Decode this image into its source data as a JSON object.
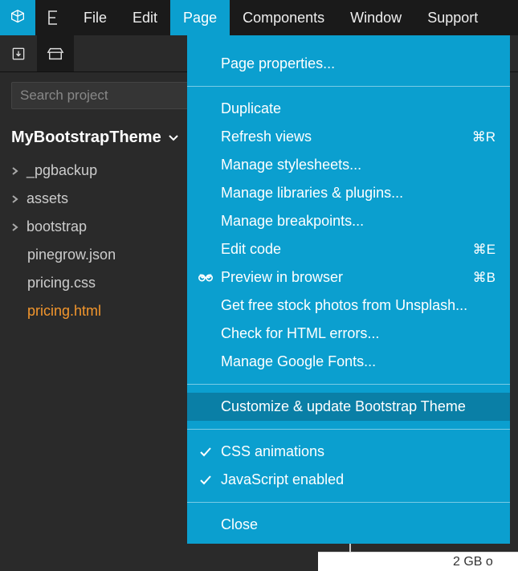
{
  "menubar": {
    "items": [
      {
        "label": "File"
      },
      {
        "label": "Edit"
      },
      {
        "label": "Page",
        "active": true
      },
      {
        "label": "Components"
      },
      {
        "label": "Window"
      },
      {
        "label": "Support"
      }
    ]
  },
  "search": {
    "placeholder": "Search project"
  },
  "project": {
    "name": "MyBootstrapTheme"
  },
  "tree": {
    "folders": [
      {
        "label": "_pgbackup"
      },
      {
        "label": "assets"
      },
      {
        "label": "bootstrap"
      }
    ],
    "files": [
      {
        "label": "pinegrow.json"
      },
      {
        "label": "pricing.css"
      },
      {
        "label": "pricing.html",
        "active": true
      }
    ]
  },
  "dropdown": {
    "group1": [
      {
        "label": "Page properties..."
      }
    ],
    "group2": [
      {
        "label": "Duplicate"
      },
      {
        "label": "Refresh views",
        "shortcut": "⌘R"
      },
      {
        "label": "Manage stylesheets..."
      },
      {
        "label": "Manage libraries & plugins..."
      },
      {
        "label": "Manage breakpoints..."
      },
      {
        "label": "Edit code",
        "shortcut": "⌘E"
      },
      {
        "label": "Preview in browser",
        "shortcut": "⌘B",
        "icon": "link"
      },
      {
        "label": "Get free stock photos from Unsplash..."
      },
      {
        "label": "Check for HTML errors..."
      },
      {
        "label": "Manage Google Fonts..."
      }
    ],
    "group3": [
      {
        "label": "Customize & update Bootstrap Theme",
        "highlight": true
      }
    ],
    "group4": [
      {
        "label": "CSS animations",
        "checked": true
      },
      {
        "label": "JavaScript enabled",
        "checked": true
      }
    ],
    "group5": [
      {
        "label": "Close"
      }
    ]
  },
  "background": {
    "snippet": "2 GB o"
  }
}
